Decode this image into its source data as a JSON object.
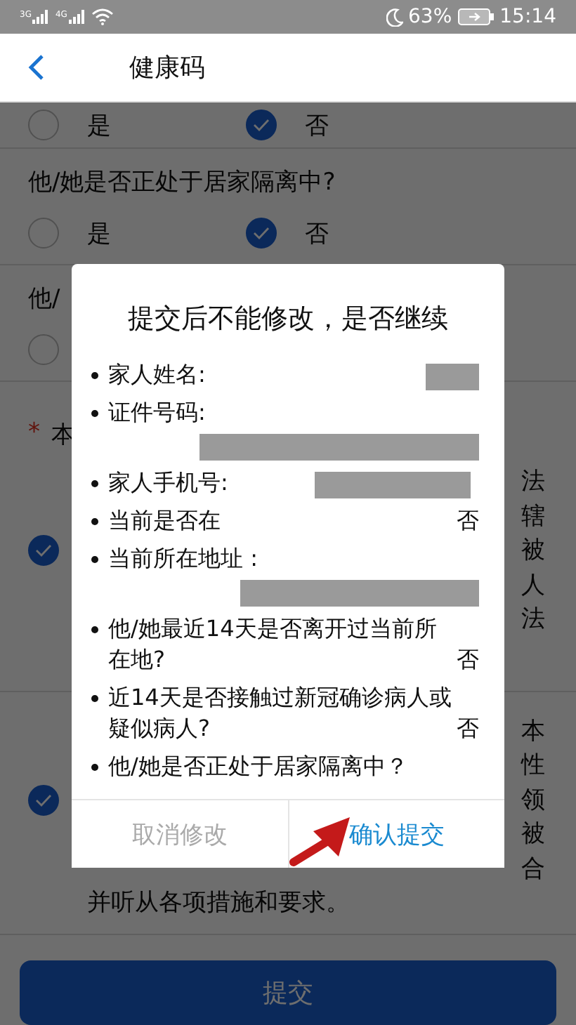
{
  "status_bar": {
    "network_1": "3G",
    "network_2": "4G",
    "battery": "63%",
    "time": "15:14"
  },
  "header": {
    "title": "健康码"
  },
  "form": {
    "top_options": [
      {
        "label": "是",
        "selected": false
      },
      {
        "label": "否",
        "selected": true
      }
    ],
    "questions": [
      {
        "text": "他/她是否正处于居家隔离中?",
        "options": [
          {
            "label": "是",
            "selected": false
          },
          {
            "label": "否",
            "selected": true
          }
        ]
      },
      {
        "text": "他/",
        "options": [
          {
            "selected": false
          }
        ]
      }
    ],
    "consent": {
      "required_mark": "*",
      "title": "本",
      "items": [
        {
          "checked": true,
          "lines": [
            "法",
            "辖",
            "被",
            "人",
            "法"
          ]
        },
        {
          "checked": true,
          "lines": [
            "本",
            "性",
            "领",
            "被",
            "合"
          ],
          "tail": "并听从各项措施和要求。"
        }
      ]
    },
    "submit": "提交"
  },
  "dialog": {
    "title": "提交后不能修改，是否继续",
    "items": [
      {
        "label": "家人姓名:",
        "kind": "redacted_short"
      },
      {
        "label": "证件号码:",
        "kind": "redacted_below"
      },
      {
        "label": "家人手机号:",
        "kind": "redacted_inline"
      },
      {
        "label": "当前是否在",
        "kind": "answer",
        "value": "否"
      },
      {
        "label": "当前所在地址 :",
        "kind": "redacted_below"
      },
      {
        "label": "他/她最近14天是否离开过当前所在地?",
        "kind": "answer",
        "value": "否"
      },
      {
        "label": "近14天是否接触过新冠确诊病人或疑似病人?",
        "kind": "answer",
        "value": "否"
      },
      {
        "label": "他/她是否正处于居家隔离中？",
        "kind": "plain"
      }
    ],
    "buttons": [
      {
        "label": "取消修改",
        "kind": "cancel"
      },
      {
        "label": "确认提交",
        "kind": "confirm"
      }
    ]
  }
}
